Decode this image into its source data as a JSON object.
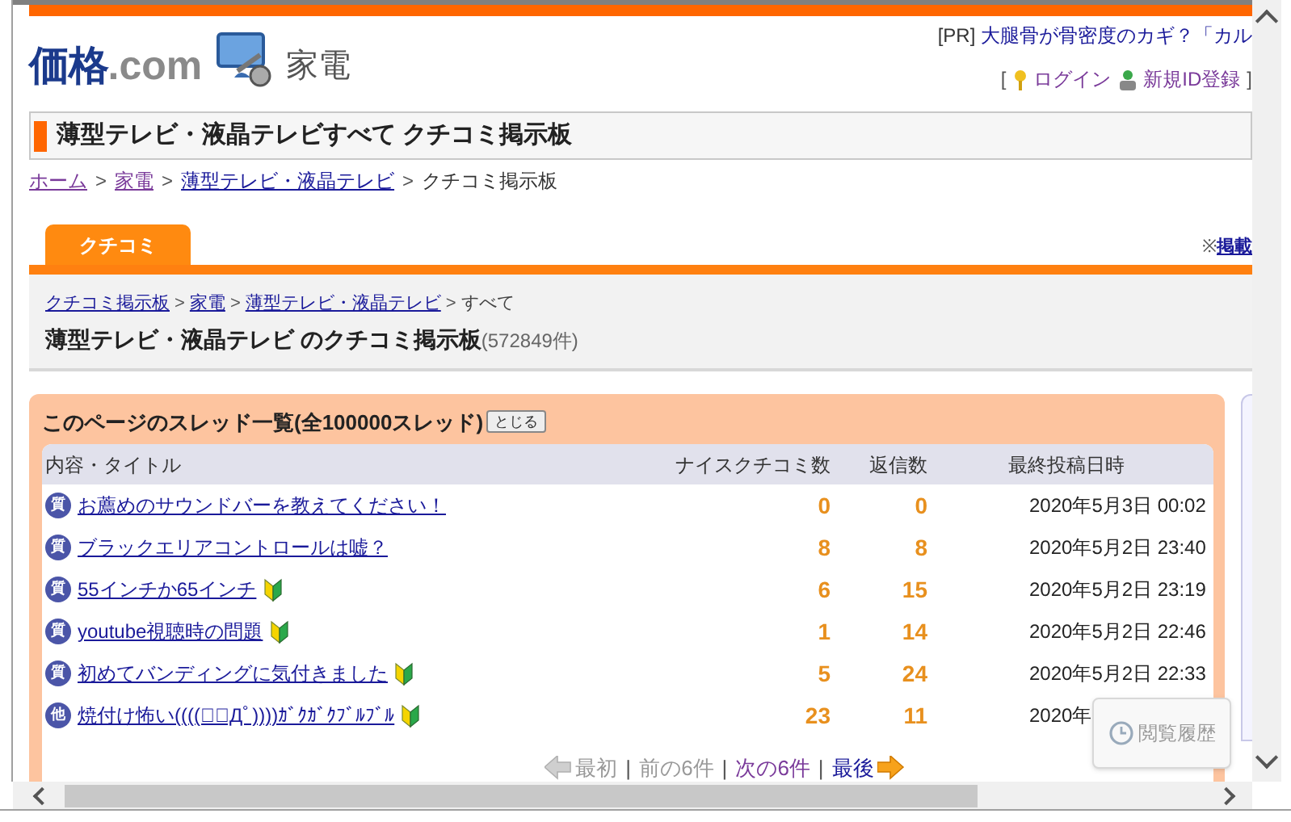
{
  "header": {
    "logo_main": "価格",
    "logo_suffix": ".com",
    "category": "家電",
    "ad_prefix": "[PR]",
    "ad_text": "大腿骨が骨密度のカギ？「カル",
    "bracket_open": "[",
    "login": "ログイン",
    "register": "新規ID登録",
    "bracket_close": "]"
  },
  "page_title": "薄型テレビ・液晶テレビすべて クチコミ掲示板",
  "breadcrumb": [
    {
      "label": "ホーム",
      "kind": "link",
      "visited": true
    },
    {
      "separator": ">",
      "label": "家電",
      "kind": "link",
      "visited": true
    },
    {
      "separator": ">",
      "label": "薄型テレビ・液晶テレビ",
      "kind": "link",
      "visited": false
    },
    {
      "separator": ">",
      "label": "クチコミ掲示板",
      "kind": "text"
    }
  ],
  "tabs": [
    {
      "label": "クチコミ",
      "selected": true
    }
  ],
  "notice": {
    "mark": "※",
    "link": "掲載"
  },
  "board": {
    "breadcrumb": [
      {
        "label": "クチコミ掲示板",
        "kind": "link"
      },
      {
        "separator": ">",
        "label": "家電",
        "kind": "link"
      },
      {
        "separator": ">",
        "label": "薄型テレビ・液晶テレビ",
        "kind": "link"
      },
      {
        "separator": ">",
        "label": "すべて",
        "kind": "text"
      }
    ],
    "title": "薄型テレビ・液晶テレビ のクチコミ掲示板",
    "count": "(572849件)"
  },
  "thread_list": {
    "heading": "このページのスレッド一覧(全100000スレッド)",
    "close_button": "とじる",
    "columns": [
      "内容・タイトル",
      "ナイスクチコミ数",
      "返信数",
      "最終投稿日時"
    ],
    "rows": [
      {
        "type_label": "質",
        "title": "お薦めのサウンドバーを教えてください！",
        "beginner": false,
        "nice": "0",
        "replies": "0",
        "date": "2020年5月3日 00:02"
      },
      {
        "type_label": "質",
        "title": "ブラックエリアコントロールは嘘？",
        "beginner": false,
        "nice": "8",
        "replies": "8",
        "date": "2020年5月2日 23:40"
      },
      {
        "type_label": "質",
        "title": "55インチか65インチ",
        "beginner": true,
        "nice": "6",
        "replies": "15",
        "date": "2020年5月2日 23:19"
      },
      {
        "type_label": "質",
        "title": "youtube視聴時の問題",
        "beginner": true,
        "nice": "1",
        "replies": "14",
        "date": "2020年5月2日 22:46"
      },
      {
        "type_label": "質",
        "title": "初めてバンディングに気付きました",
        "beginner": true,
        "nice": "5",
        "replies": "24",
        "date": "2020年5月2日 22:33"
      },
      {
        "type_label": "他",
        "title": "焼付け怖い((((；ﾟДﾟ))))ｶﾞｸｶﾞｸﾌﾞﾙﾌﾞﾙ",
        "beginner": true,
        "nice": "23",
        "replies": "11",
        "date": "2020年"
      }
    ],
    "pager": [
      {
        "label": "最初",
        "kind": "first",
        "enabled": false
      },
      {
        "separator": "|",
        "label": "前の6件",
        "kind": "prev",
        "enabled": false
      },
      {
        "separator": "|",
        "label": "次の6件",
        "kind": "next",
        "enabled": true,
        "visited": true
      },
      {
        "separator": "|",
        "label": "最後",
        "kind": "last",
        "enabled": true,
        "visited": false
      }
    ]
  },
  "history_button": "閲覧履歴"
}
